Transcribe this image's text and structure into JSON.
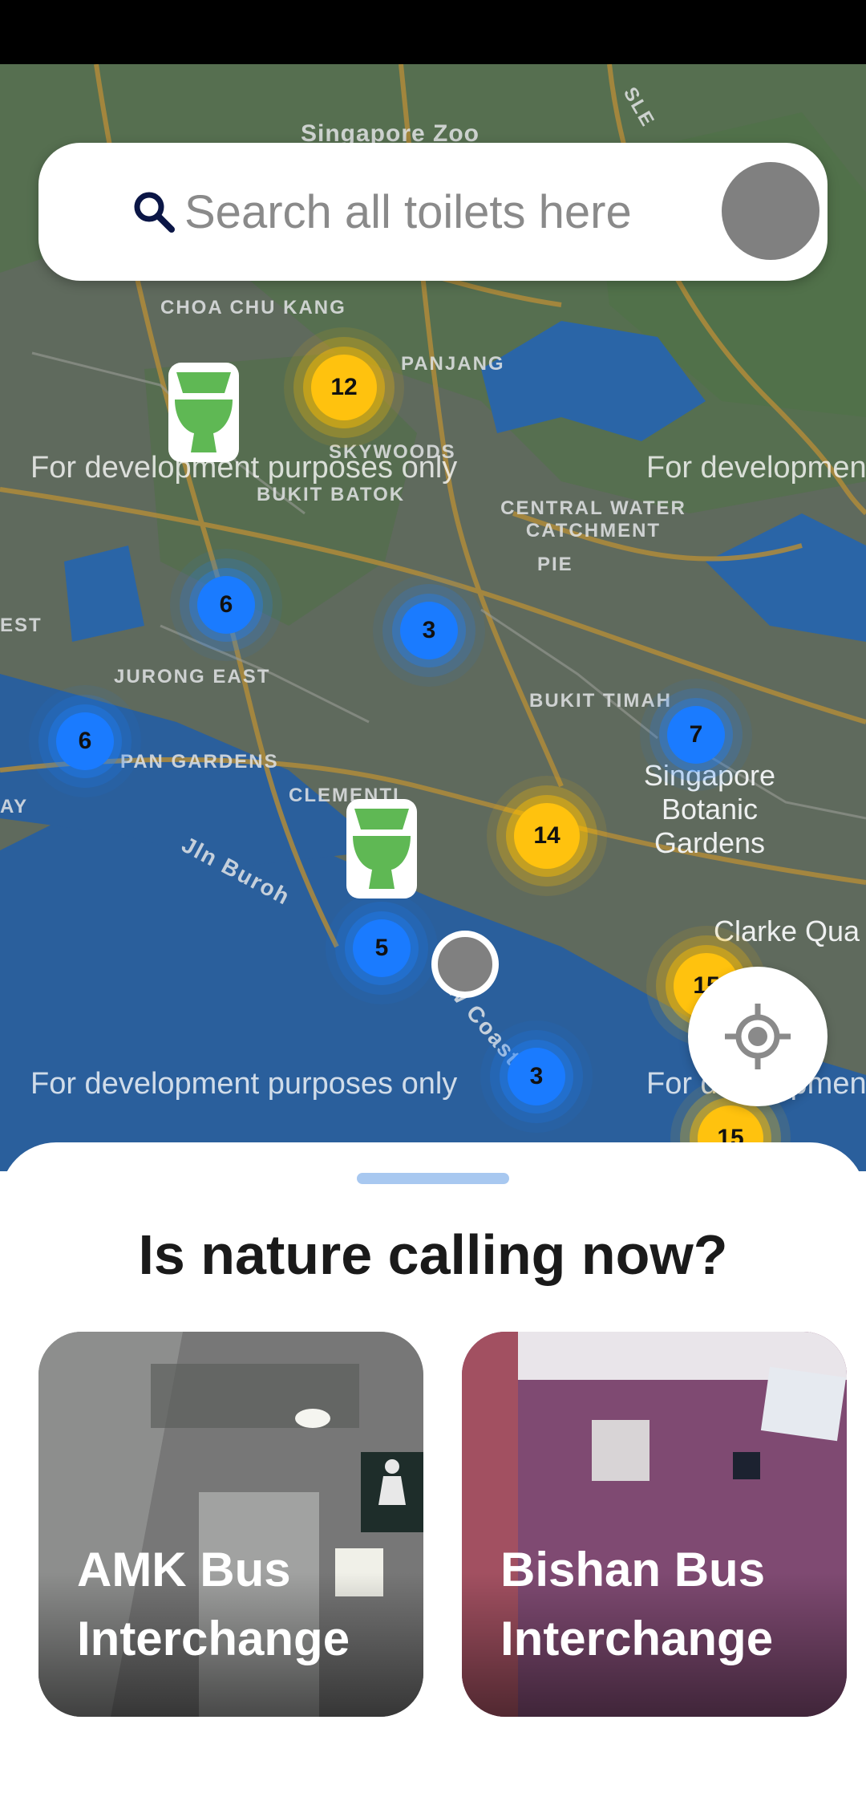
{
  "map": {
    "place_labels": [
      "Singapore Zoo",
      "CHOA CHU KANG",
      "PANJANG",
      "SKYWOODS",
      "BUKIT BATOK",
      "CENTRAL WATER CATCHMENT",
      "JURONG EAST",
      "PAN GARDENS",
      "CLEMENTI",
      "BUKIT TIMAH",
      "Singapore Botanic Gardens",
      "Clarke Qua",
      "EST",
      "AY",
      "Jln Buroh",
      "W Coast",
      "PIE",
      "SLE"
    ],
    "watermark": "For development purposes only",
    "clusters": [
      {
        "count": "12",
        "color": "yellow"
      },
      {
        "count": "6",
        "color": "blue"
      },
      {
        "count": "3",
        "color": "blue"
      },
      {
        "count": "6",
        "color": "blue"
      },
      {
        "count": "7",
        "color": "blue"
      },
      {
        "count": "14",
        "color": "yellow"
      },
      {
        "count": "5",
        "color": "blue"
      },
      {
        "count": "3",
        "color": "blue"
      },
      {
        "count": "15",
        "color": "yellow"
      },
      {
        "count": "15",
        "color": "yellow"
      }
    ]
  },
  "search": {
    "placeholder": "Search all toilets here"
  },
  "sheet": {
    "title": "Is nature calling now?",
    "cards": [
      {
        "name": "AMK Bus Interchange"
      },
      {
        "name": "Bishan Bus Interchange"
      }
    ]
  },
  "colors": {
    "cluster_blue": "#1a7bff",
    "cluster_yellow": "#ffc20e",
    "toilet_green": "#5fb854",
    "handle": "#a8c8f0"
  }
}
